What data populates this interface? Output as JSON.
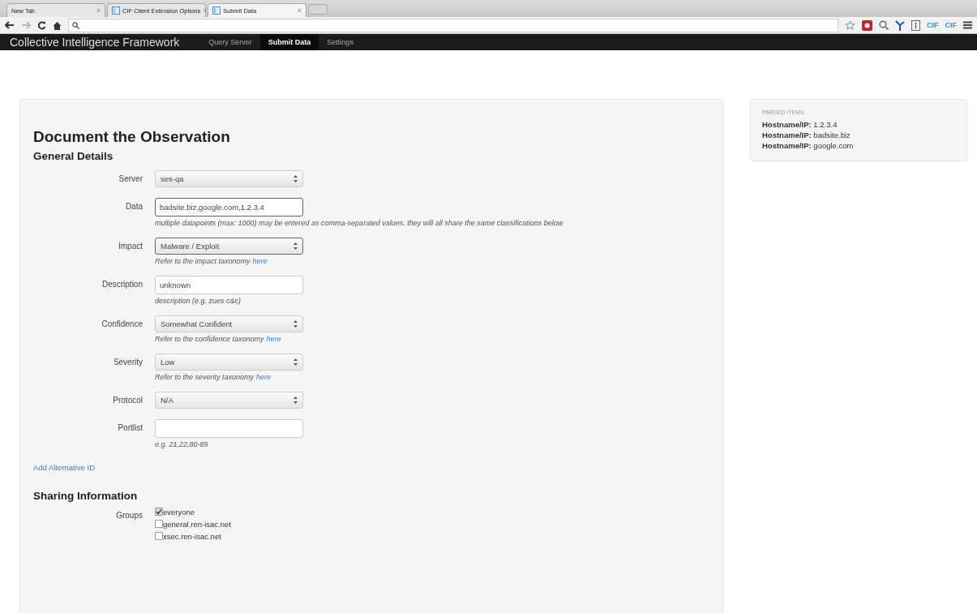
{
  "browser": {
    "tabs": [
      {
        "title": "New Tab",
        "favicon": false,
        "selected": false
      },
      {
        "title": "CIF Client Extension Options",
        "favicon": true,
        "selected": false
      },
      {
        "title": "Submit Data",
        "favicon": true,
        "selected": true
      }
    ],
    "close_glyph": "×",
    "toolbar_icons": [
      {
        "kind": "star"
      },
      {
        "kind": "red"
      },
      {
        "kind": "search"
      },
      {
        "kind": "fork"
      },
      {
        "kind": "box",
        "label": "I"
      },
      {
        "kind": "cif",
        "label": "CIF"
      },
      {
        "kind": "cif",
        "label": "CIF"
      },
      {
        "kind": "menu"
      }
    ]
  },
  "navbar": {
    "brand": "Collective Intelligence Framework",
    "links": [
      {
        "label": "Query Server",
        "selected": false
      },
      {
        "label": "Submit Data",
        "selected": true
      },
      {
        "label": "Settings",
        "selected": false
      }
    ]
  },
  "form": {
    "title": "Document the Observation",
    "section": "General Details",
    "fields": [
      {
        "kind": "select",
        "label": "Server",
        "value": "ses-qa",
        "focused": false
      },
      {
        "kind": "textarea",
        "label": "Data",
        "value": "badsite.biz,google.com,1.2.3.4",
        "focused": true,
        "help": "multiple datapoints (max: 1000) may be entered as comma-separated values. they will all share the same classifications below"
      },
      {
        "kind": "select",
        "label": "Impact",
        "value": "Malware / Exploit",
        "focused": true,
        "help": "Refer to the impact taxonomy",
        "help_link": "here"
      },
      {
        "kind": "textarea",
        "label": "Description",
        "value": "unknown",
        "focused": false,
        "help": "description (e.g. zues c&c)"
      },
      {
        "kind": "select",
        "label": "Confidence",
        "value": "Somewhat Confident",
        "focused": false,
        "help": "Refer to the confidence taxonomy",
        "help_link": "here"
      },
      {
        "kind": "select",
        "label": "Severity",
        "value": "Low",
        "focused": false,
        "help": "Refer to the severity taxonomy",
        "help_link": "here"
      },
      {
        "kind": "select",
        "label": "Protocol",
        "value": "N/A",
        "focused": false
      },
      {
        "kind": "input",
        "label": "Portlist",
        "focused": false,
        "help": "e.g. 21,22,80-89"
      }
    ],
    "add_link": "Add Alternative ID",
    "sharing": {
      "title": "Sharing Information",
      "label": "Groups",
      "groups": [
        {
          "name": "everyone",
          "checked": true
        },
        {
          "name": "general.ren-isac.net",
          "checked": false
        },
        {
          "name": "xsec.ren-isac.net",
          "checked": false
        }
      ]
    }
  },
  "parsed": {
    "title": "PARSED ITEMS",
    "items": [
      {
        "key": "Hostname/IP:",
        "value": "1.2.3.4"
      },
      {
        "key": "Hostname/IP:",
        "value": "badsite.biz"
      },
      {
        "key": "Hostname/IP:",
        "value": "google.com"
      }
    ]
  }
}
